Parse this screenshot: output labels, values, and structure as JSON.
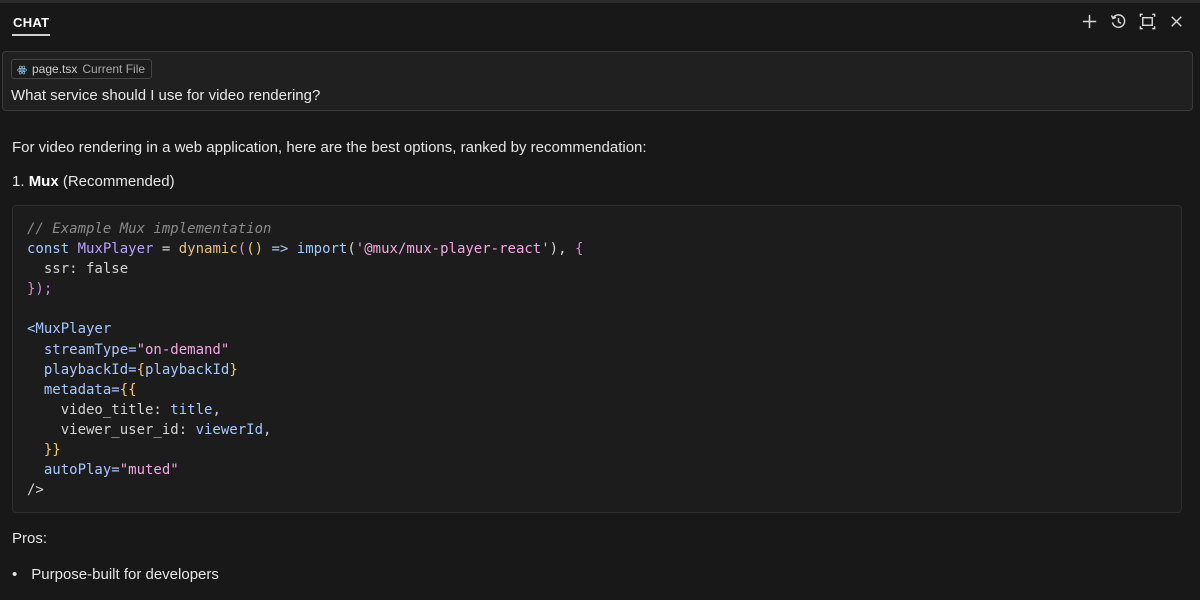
{
  "header": {
    "tab_label": "CHAT",
    "icons": [
      "plus-icon",
      "history-icon",
      "maximize-icon",
      "close-icon"
    ]
  },
  "prompt": {
    "file_chip": {
      "name": "page.tsx",
      "tag": "Current File"
    },
    "text": "What service should I use for video rendering?"
  },
  "answer": {
    "intro": "For video rendering in a web application, here are the best options, ranked by recommendation:",
    "item_number": "1.",
    "item_name": "Mux",
    "item_note": "(Recommended)",
    "code": {
      "comment": "// Example Mux implementation",
      "kw_const": "const",
      "var_name": "MuxPlayer",
      "eq": " = ",
      "fn_dynamic": "dynamic",
      "paren_open": "(",
      "arrow_parens": "()",
      "arrow": " => ",
      "kw_import": "import",
      "paren_import_open": "(",
      "import_path": "'@mux/mux-player-react'",
      "paren_import_close": ")",
      "comma_space": ", ",
      "brace_open": "{",
      "ssr_line": "  ssr: false",
      "close_line": "});",
      "jsx_open": "<MuxPlayer",
      "attr_stream": "  streamType=",
      "val_stream": "\"on-demand\"",
      "attr_playback": "  playbackId=",
      "val_playback_open": "{",
      "val_playback": "playbackId",
      "val_playback_close": "}",
      "attr_metadata": "  metadata=",
      "val_metadata_open": "{{",
      "meta_title_key": "    video_title: ",
      "meta_title_val": "title",
      "meta_title_comma": ",",
      "meta_viewer_key": "    viewer_user_id: ",
      "meta_viewer_val": "viewerId",
      "meta_viewer_comma": ",",
      "meta_close": "  }}",
      "attr_autoplay": "  autoPlay=",
      "val_autoplay": "\"muted\"",
      "jsx_close": "/>"
    },
    "pros_label": "Pros:",
    "pros": [
      "Purpose-built for developers"
    ]
  },
  "colors": {
    "background": "#181818",
    "prompt_bg": "#202020",
    "code_bg": "#1c1c1c"
  }
}
